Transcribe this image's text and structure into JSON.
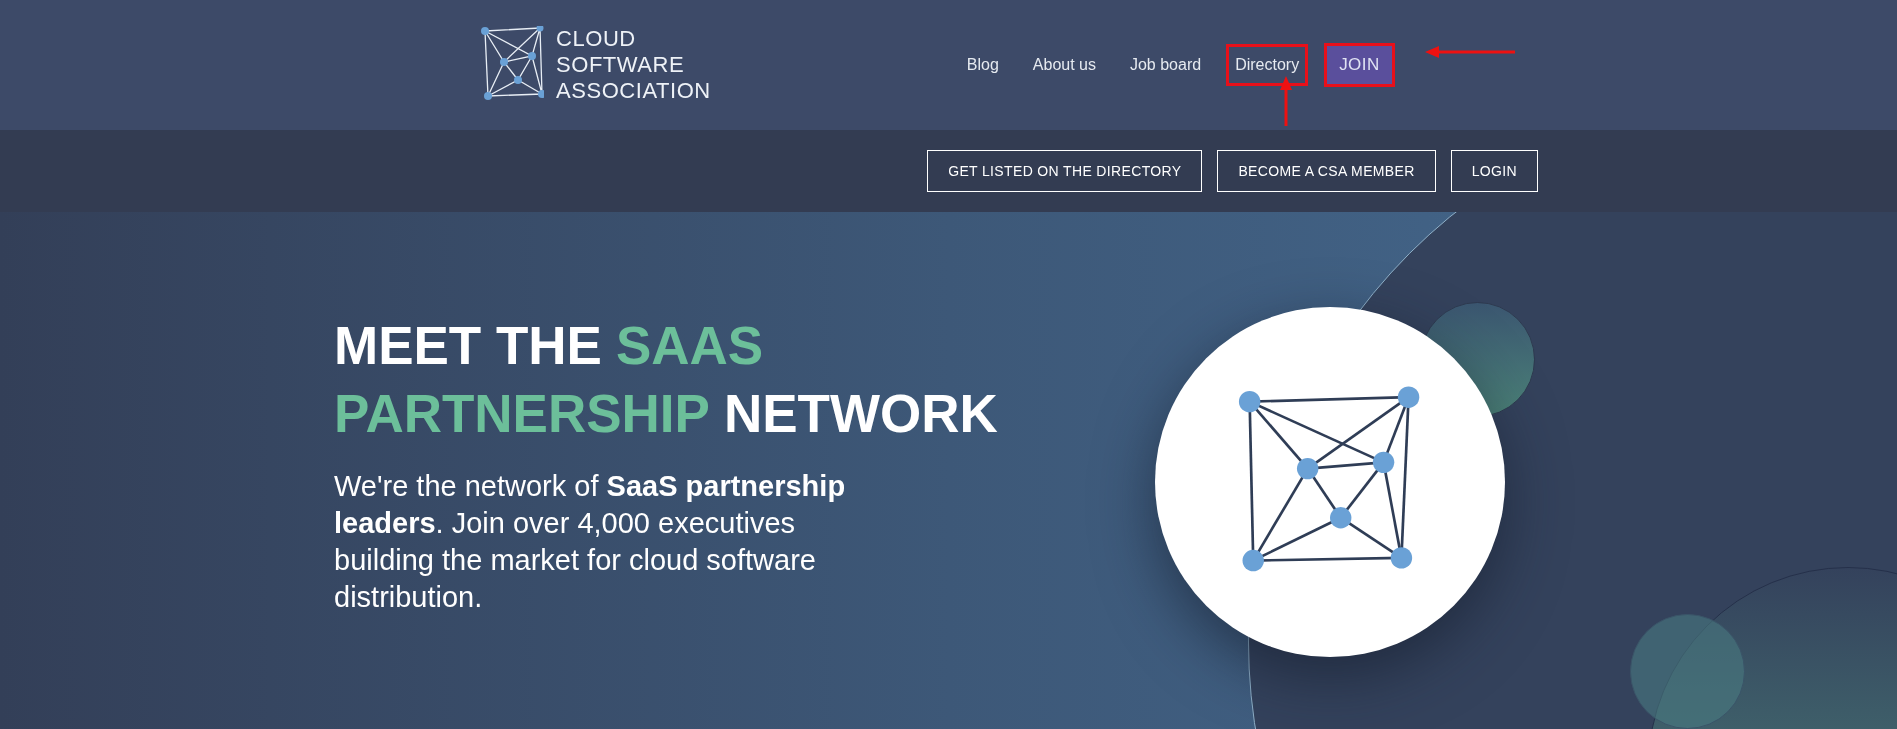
{
  "logo": {
    "lines": [
      "CLOUD",
      "SOFTWARE",
      "ASSOCIATION"
    ]
  },
  "nav": [
    {
      "label": "Blog",
      "highlighted": false,
      "kind": "link"
    },
    {
      "label": "About us",
      "highlighted": false,
      "kind": "link"
    },
    {
      "label": "Job board",
      "highlighted": false,
      "kind": "link"
    },
    {
      "label": "Directory",
      "highlighted": true,
      "kind": "link"
    },
    {
      "label": "JOIN",
      "highlighted": true,
      "kind": "button"
    }
  ],
  "actions": [
    "GET LISTED ON THE DIRECTORY",
    "BECOME A CSA MEMBER",
    "LOGIN"
  ],
  "hero": {
    "headline": [
      [
        {
          "text": "MEET THE",
          "accent": false
        },
        {
          "text": "SAAS",
          "accent": true
        }
      ],
      [
        {
          "text": "PARTNERSHIP",
          "accent": true
        },
        {
          "text": "NETWORK",
          "accent": false
        }
      ]
    ],
    "body": "We're the network of **SaaS partnership leaders**. Join over 4,000 executives building the market for cloud software distribution."
  }
}
